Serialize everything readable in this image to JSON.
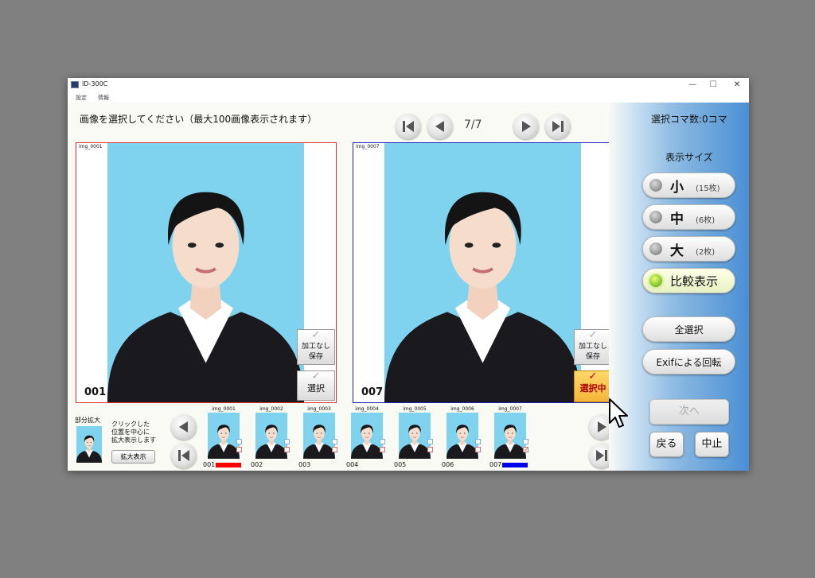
{
  "window": {
    "title": "ID-300C",
    "minimize": "—",
    "maximize": "☐",
    "close": "✕"
  },
  "menu": {
    "settings": "設定",
    "info": "情報"
  },
  "instruction": "画像を選択してください（最大100画像表示されます）",
  "pager": {
    "text": "7/7"
  },
  "panels": [
    {
      "name": "img_0001",
      "number": "001",
      "border": "#e03030",
      "save_label_1": "加工なし",
      "save_label_2": "保存",
      "select_label": "選択",
      "selected": false
    },
    {
      "name": "img_0007",
      "number": "007",
      "border": "#2020c0",
      "save_label_1": "加工なし",
      "save_label_2": "保存",
      "select_label": "選択中",
      "selected": true
    }
  ],
  "right": {
    "selected_count": "選択コマ数:0コマ",
    "size_title": "表示サイズ",
    "sizes": [
      {
        "big": "小",
        "small": "(15枚)"
      },
      {
        "big": "中",
        "small": "(6枚)"
      },
      {
        "big": "大",
        "small": "(2枚)"
      }
    ],
    "compare": "比較表示",
    "select_all": "全選択",
    "exif_rotate": "Exifによる回転",
    "next": "次へ",
    "back": "戻る",
    "stop": "中止"
  },
  "zoom": {
    "title": "部分拡大",
    "desc1": "クリックした",
    "desc2": "位置を中心に",
    "desc3": "拡大表示します",
    "button": "拡大表示"
  },
  "thumbnails": [
    {
      "name": "img_0001",
      "number": "001",
      "bar": "#ff0000",
      "checked": false
    },
    {
      "name": "img_0002",
      "number": "002",
      "bar": "",
      "checked": false
    },
    {
      "name": "img_0003",
      "number": "003",
      "bar": "",
      "checked": false
    },
    {
      "name": "img_0004",
      "number": "004",
      "bar": "",
      "checked": false
    },
    {
      "name": "img_0005",
      "number": "005",
      "bar": "",
      "checked": false
    },
    {
      "name": "img_0006",
      "number": "006",
      "bar": "",
      "checked": false
    },
    {
      "name": "img_0007",
      "number": "007",
      "bar": "#0000ee",
      "checked": true
    }
  ],
  "colors": {
    "accent_blue": "#4a8fd4",
    "selected_yellow": "#f7c348",
    "photo_bg": "#7fd3ee"
  }
}
